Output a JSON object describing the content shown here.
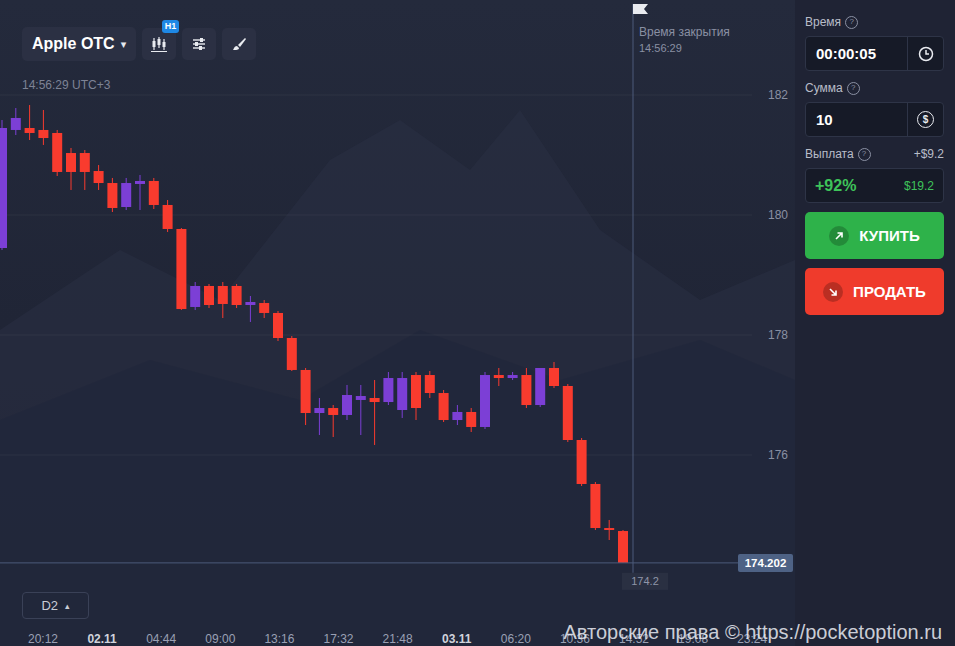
{
  "toolbar": {
    "asset": "Apple OTC",
    "arrow": "▾",
    "badge": "H1"
  },
  "clock": "14:56:29 UTC+3",
  "expiry": {
    "label": "Время закрытия",
    "time": "14:56:29"
  },
  "chart": {
    "price_ticks": [
      "182",
      "180",
      "178",
      "176"
    ],
    "time_ticks": [
      {
        "label": "20:12",
        "kind": "time"
      },
      {
        "label": "02.11",
        "kind": "date"
      },
      {
        "label": "04:44",
        "kind": "time"
      },
      {
        "label": "09:00",
        "kind": "time"
      },
      {
        "label": "13:16",
        "kind": "time"
      },
      {
        "label": "17:32",
        "kind": "time"
      },
      {
        "label": "21:48",
        "kind": "time"
      },
      {
        "label": "03.11",
        "kind": "date"
      },
      {
        "label": "06:20",
        "kind": "time"
      },
      {
        "label": "10:36",
        "kind": "time"
      },
      {
        "label": "14:52",
        "kind": "time"
      },
      {
        "label": "19:08",
        "kind": "time"
      },
      {
        "label": "23:24",
        "kind": "time"
      }
    ],
    "candles": [
      {
        "open": 179.45,
        "high": 181.583,
        "low": 179.417,
        "close": 181.45
      },
      {
        "open": 181.417,
        "high": 181.783,
        "low": 181.333,
        "close": 181.617
      },
      {
        "open": 181.45,
        "high": 181.833,
        "low": 181.25,
        "close": 181.367
      },
      {
        "open": 181.417,
        "high": 181.75,
        "low": 181.167,
        "close": 181.283
      },
      {
        "open": 181.367,
        "high": 181.417,
        "low": 180.65,
        "close": 180.717
      },
      {
        "open": 181.033,
        "high": 181.117,
        "low": 180.417,
        "close": 180.717
      },
      {
        "open": 181.033,
        "high": 181.083,
        "low": 180.417,
        "close": 180.717
      },
      {
        "open": 180.733,
        "high": 180.833,
        "low": 180.417,
        "close": 180.533
      },
      {
        "open": 180.533,
        "high": 180.617,
        "low": 180.05,
        "close": 180.117
      },
      {
        "open": 180.133,
        "high": 180.617,
        "low": 180.083,
        "close": 180.533
      },
      {
        "open": 180.517,
        "high": 180.667,
        "low": 180.083,
        "close": 180.567
      },
      {
        "open": 180.567,
        "high": 180.617,
        "low": 180.1,
        "close": 180.167
      },
      {
        "open": 180.167,
        "high": 180.25,
        "low": 179.717,
        "close": 179.767
      },
      {
        "open": 179.767,
        "high": 179.783,
        "low": 178.417,
        "close": 178.433
      },
      {
        "open": 178.467,
        "high": 178.883,
        "low": 178.417,
        "close": 178.817
      },
      {
        "open": 178.817,
        "high": 178.85,
        "low": 178.45,
        "close": 178.5
      },
      {
        "open": 178.817,
        "high": 178.883,
        "low": 178.283,
        "close": 178.517
      },
      {
        "open": 178.817,
        "high": 178.85,
        "low": 178.45,
        "close": 178.5
      },
      {
        "open": 178.5,
        "high": 178.65,
        "low": 178.217,
        "close": 178.55
      },
      {
        "open": 178.533,
        "high": 178.583,
        "low": 178.283,
        "close": 178.367
      },
      {
        "open": 178.367,
        "high": 178.4,
        "low": 177.9,
        "close": 177.95
      },
      {
        "open": 177.95,
        "high": 177.983,
        "low": 177.4,
        "close": 177.417
      },
      {
        "open": 177.417,
        "high": 177.45,
        "low": 176.5,
        "close": 176.7
      },
      {
        "open": 176.7,
        "high": 176.95,
        "low": 176.333,
        "close": 176.783
      },
      {
        "open": 176.783,
        "high": 176.833,
        "low": 176.3,
        "close": 176.667
      },
      {
        "open": 176.667,
        "high": 177.167,
        "low": 176.583,
        "close": 177.0
      },
      {
        "open": 176.917,
        "high": 177.167,
        "low": 176.333,
        "close": 176.983
      },
      {
        "open": 176.95,
        "high": 177.25,
        "low": 176.167,
        "close": 176.883
      },
      {
        "open": 176.883,
        "high": 177.383,
        "low": 176.833,
        "close": 177.283
      },
      {
        "open": 176.75,
        "high": 177.383,
        "low": 176.617,
        "close": 177.283
      },
      {
        "open": 177.333,
        "high": 177.383,
        "low": 176.583,
        "close": 176.783
      },
      {
        "open": 177.333,
        "high": 177.4,
        "low": 176.95,
        "close": 177.033
      },
      {
        "open": 177.033,
        "high": 177.083,
        "low": 176.55,
        "close": 176.583
      },
      {
        "open": 176.583,
        "high": 176.833,
        "low": 176.5,
        "close": 176.717
      },
      {
        "open": 176.717,
        "high": 176.783,
        "low": 176.383,
        "close": 176.467
      },
      {
        "open": 176.467,
        "high": 177.383,
        "low": 176.433,
        "close": 177.333
      },
      {
        "open": 177.333,
        "high": 177.45,
        "low": 177.15,
        "close": 177.283
      },
      {
        "open": 177.283,
        "high": 177.383,
        "low": 177.25,
        "close": 177.333
      },
      {
        "open": 177.333,
        "high": 177.45,
        "low": 176.783,
        "close": 176.833
      },
      {
        "open": 176.833,
        "high": 177.45,
        "low": 176.8,
        "close": 177.45
      },
      {
        "open": 177.45,
        "high": 177.55,
        "low": 177.117,
        "close": 177.15
      },
      {
        "open": 177.15,
        "high": 177.183,
        "low": 176.217,
        "close": 176.25
      },
      {
        "open": 176.25,
        "high": 176.283,
        "low": 175.483,
        "close": 175.517
      },
      {
        "open": 175.517,
        "high": 175.55,
        "low": 174.75,
        "close": 174.783
      },
      {
        "open": 174.783,
        "high": 174.917,
        "low": 174.583,
        "close": 174.75
      },
      {
        "open": 174.733,
        "high": 174.75,
        "low": 174.2,
        "close": 174.202
      }
    ],
    "current_price": "174.202",
    "cursor_price": "174.2"
  },
  "zoom": {
    "label": "D2",
    "arrow": "▴"
  },
  "watermark": "Авторские права © https://pocketoption.ru",
  "panel": {
    "time": {
      "label": "Время",
      "help": "?",
      "value": "00:00:05"
    },
    "amount": {
      "label": "Сумма",
      "help": "?",
      "value": "10",
      "icon": "$"
    },
    "payout": {
      "label": "Выплата",
      "help": "?",
      "profit": "+$9.2",
      "percent": "+92%",
      "total": "$19.2"
    },
    "buttons": [
      {
        "label": "КУПИТЬ",
        "kind": "buy"
      },
      {
        "label": "ПРОДАТЬ",
        "kind": "sell"
      }
    ]
  }
}
